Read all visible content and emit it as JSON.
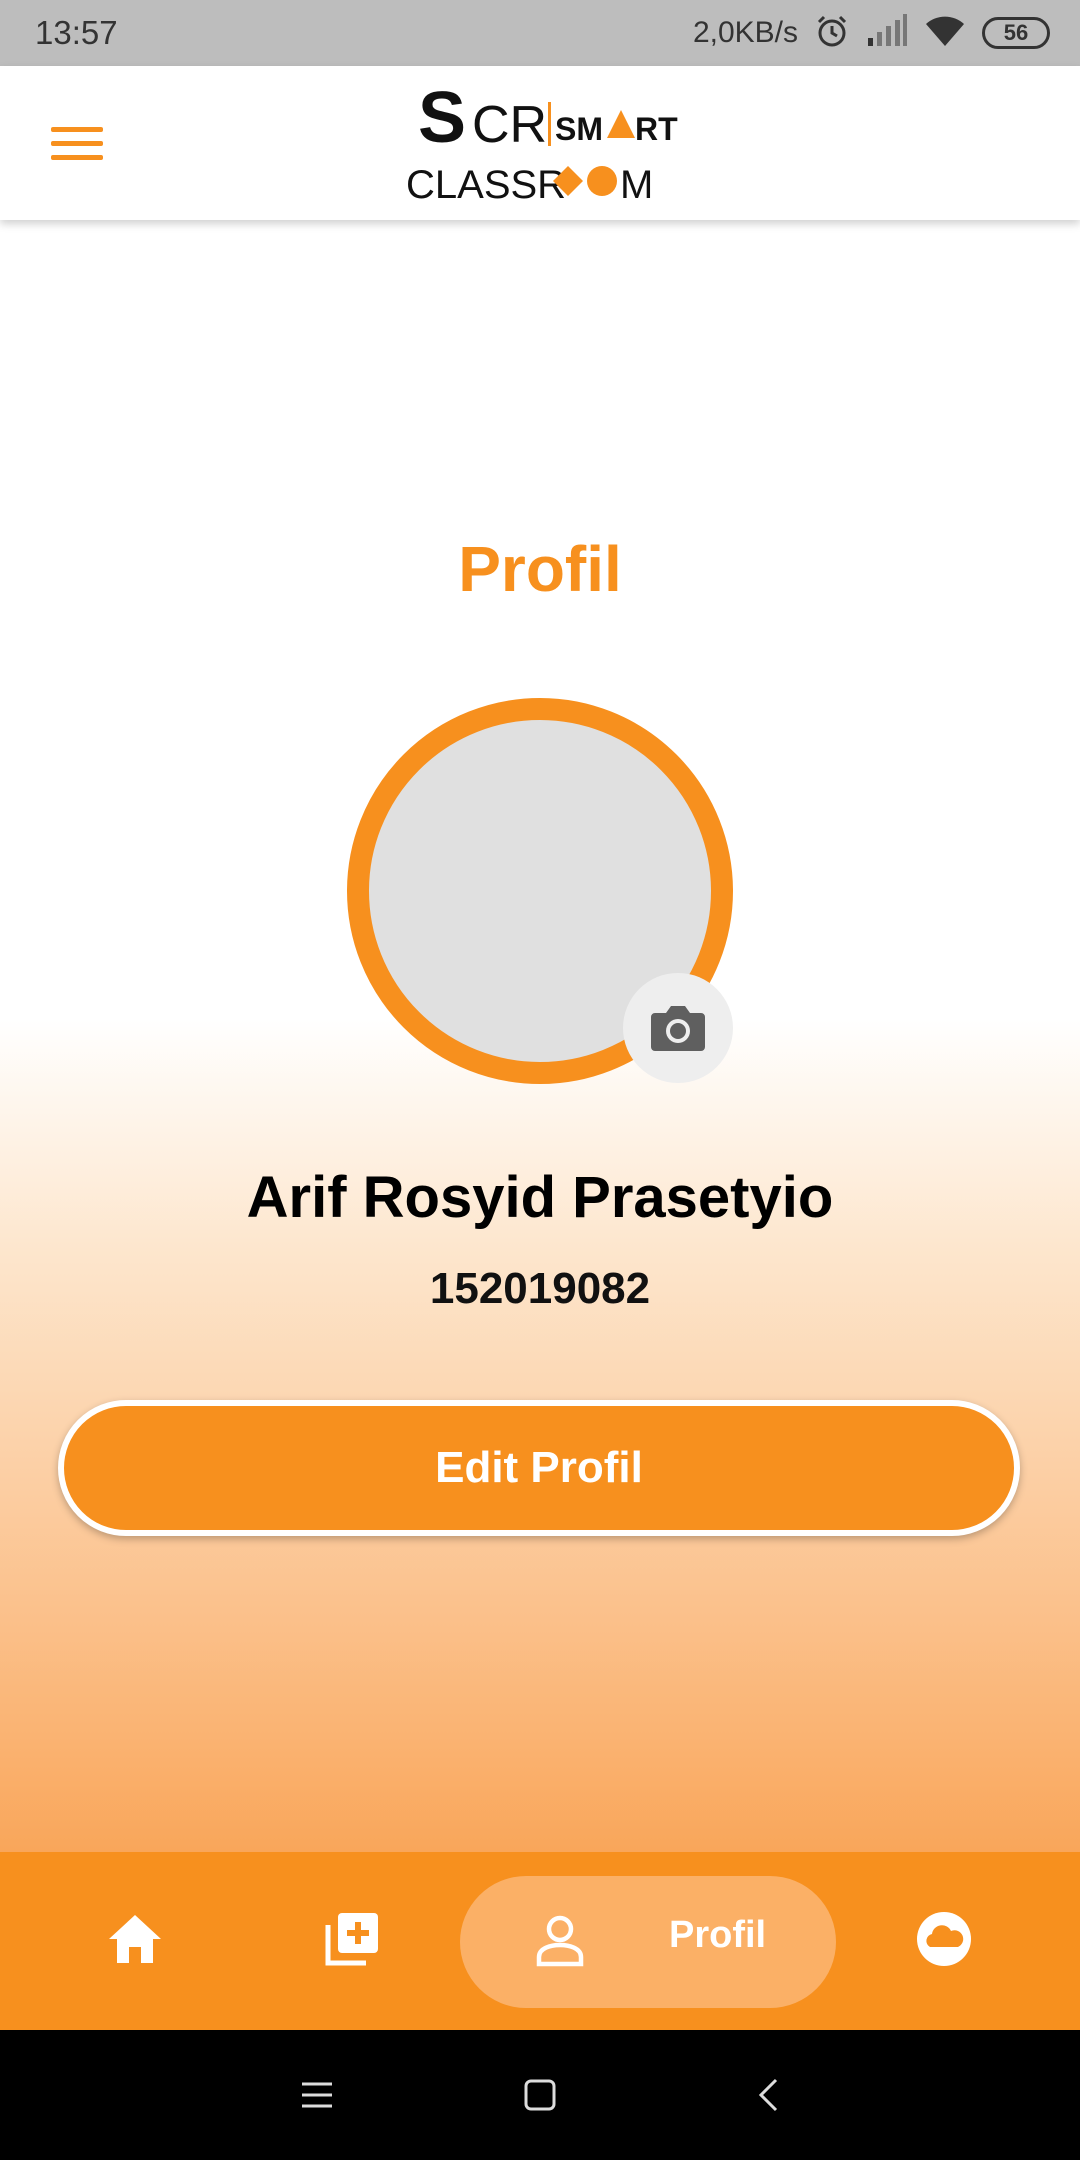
{
  "status_bar": {
    "time": "13:57",
    "network_speed": "2,0KB/s",
    "battery_level": "56",
    "icons": [
      "alarm-icon",
      "signal-icon",
      "wifi-icon",
      "battery-icon"
    ]
  },
  "app_bar": {
    "logo": {
      "mark": "SCR",
      "line1": "SMART",
      "line2": "CLASSROOM"
    },
    "menu_icon": "hamburger-menu-icon"
  },
  "profile": {
    "title": "Profil",
    "name": "Arif Rosyid Prasetyio",
    "id_number": "152019082",
    "edit_button_label": "Edit Profil",
    "camera_icon": "camera-icon"
  },
  "bottom_nav": {
    "items": [
      {
        "icon": "home-icon",
        "label": ""
      },
      {
        "icon": "add-collection-icon",
        "label": ""
      },
      {
        "icon": "person-icon",
        "label": "Profil",
        "active": true
      },
      {
        "icon": "cloud-icon",
        "label": ""
      }
    ]
  },
  "colors": {
    "accent": "#f7901e",
    "accent_light": "#fbb066",
    "status_bar": "#bdbdbd"
  }
}
